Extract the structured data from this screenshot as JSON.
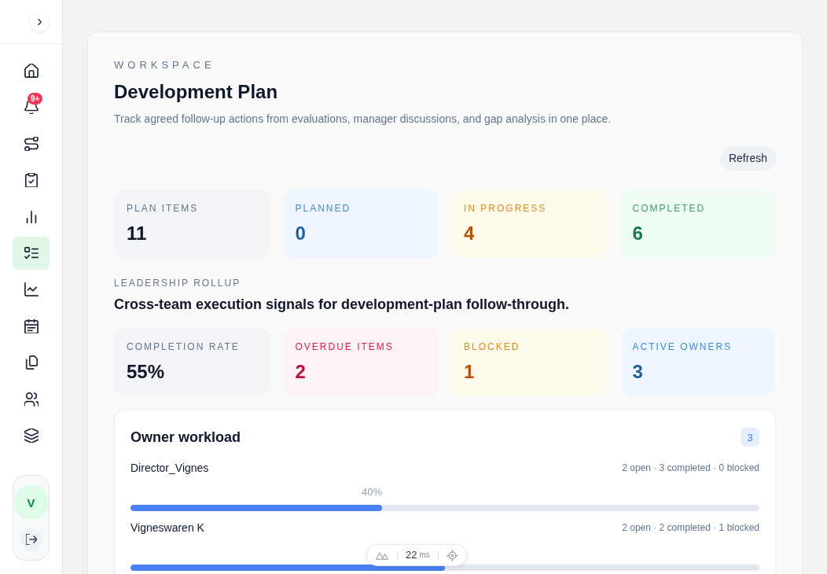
{
  "sidebar": {
    "expanded": false,
    "items": [
      {
        "selected": false
      },
      {
        "selected": false,
        "badge": "9+"
      },
      {
        "selected": false
      },
      {
        "selected": false
      },
      {
        "selected": false
      },
      {
        "selected": true
      },
      {
        "selected": false
      },
      {
        "selected": false
      },
      {
        "selected": false
      },
      {
        "selected": false
      },
      {
        "selected": false
      }
    ],
    "user": {
      "initial": "V"
    }
  },
  "header": {
    "eyebrow": "WORKSPACE",
    "title": "Development Plan",
    "description": "Track agreed follow-up actions from evaluations, manager discussions, and gap analysis in one place.",
    "refresh_button": "Refresh"
  },
  "summary": [
    {
      "label": "PLAN ITEMS",
      "value": "11",
      "kind": "neutral"
    },
    {
      "label": "PLANNED",
      "value": "0",
      "kind": "info"
    },
    {
      "label": "IN PROGRESS",
      "value": "4",
      "kind": "warning"
    },
    {
      "label": "COMPLETED",
      "value": "6",
      "kind": "success"
    }
  ],
  "rollup": {
    "eyebrow": "LEADERSHIP ROLLUP",
    "title": "Cross-team execution signals for development-plan follow-through.",
    "metrics": [
      {
        "label": "COMPLETION RATE",
        "value": "55%",
        "kind": "neutral"
      },
      {
        "label": "OVERDUE ITEMS",
        "value": "2",
        "kind": "danger"
      },
      {
        "label": "BLOCKED",
        "value": "1",
        "kind": "warning"
      },
      {
        "label": "ACTIVE OWNERS",
        "value": "3",
        "kind": "info"
      }
    ]
  },
  "workload": {
    "title": "Owner workload",
    "count": "3",
    "owners": [
      {
        "name": "Director_Vignes",
        "stats": "2 open · 3 completed · 0 blocked",
        "percent": "40%",
        "level": 0.4
      },
      {
        "name": "Vigneswaren K",
        "stats": "2 open · 2 completed · 1 blocked",
        "level": 0.5
      }
    ]
  },
  "devtools": {
    "time": "22",
    "unit": "ms"
  }
}
